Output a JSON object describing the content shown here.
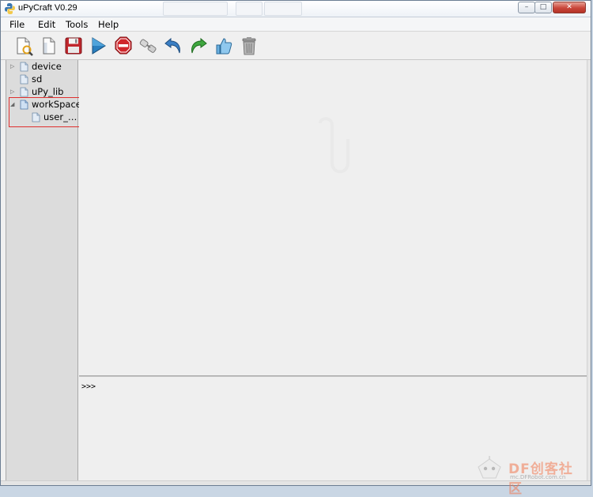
{
  "window": {
    "title": "uPyCraft V0.29",
    "ghost_tabs": [
      "",
      "",
      ""
    ],
    "controls": {
      "minimize": "–",
      "maximize": "□",
      "close": "✕"
    }
  },
  "menu": {
    "items": [
      "File",
      "Edit",
      "Tools",
      "Help"
    ]
  },
  "toolbar": {
    "icons": [
      "new-file-icon",
      "open-file-icon",
      "save-icon",
      "run-icon",
      "stop-icon",
      "connect-icon",
      "undo-icon",
      "redo-icon",
      "syntax-check-icon",
      "clear-icon"
    ]
  },
  "tree": {
    "nodes": [
      {
        "label": "device",
        "expander": "▷",
        "level": 0
      },
      {
        "label": "sd",
        "expander": "",
        "level": 0
      },
      {
        "label": "uPy_lib",
        "expander": "▷",
        "level": 0
      },
      {
        "label": "workSpace",
        "expander": "◢",
        "level": 0
      },
      {
        "label": "user_…",
        "expander": "",
        "level": 1
      }
    ]
  },
  "shell": {
    "prompt": ">>>"
  },
  "watermark": {
    "brand": "DF创客社区",
    "sub": "mc.DFRobot.com.cn"
  },
  "colors": {
    "highlight": "#e0302e",
    "sidebar_bg": "#dcdcdc",
    "editor_bg": "#efefef"
  }
}
